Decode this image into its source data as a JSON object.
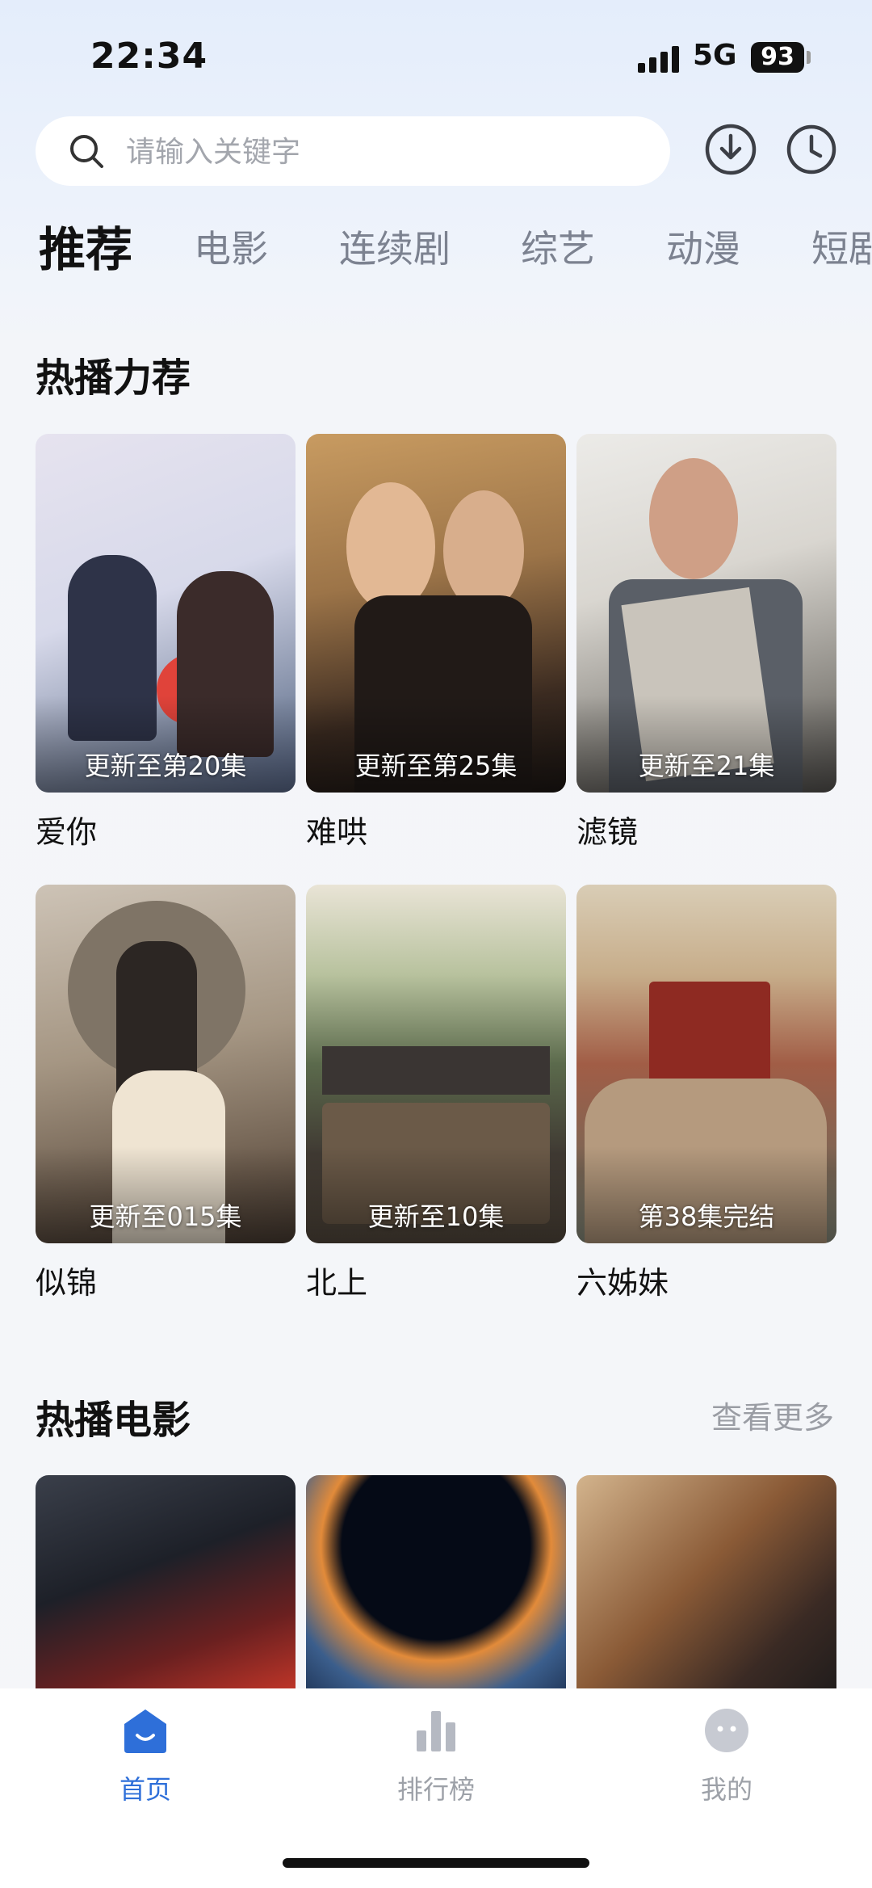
{
  "status_bar": {
    "time": "22:34",
    "network": "5G",
    "battery": "93"
  },
  "search": {
    "placeholder": "请输入关键字"
  },
  "tabs": [
    {
      "label": "推荐",
      "active": true
    },
    {
      "label": "电影"
    },
    {
      "label": "连续剧"
    },
    {
      "label": "综艺"
    },
    {
      "label": "动漫"
    },
    {
      "label": "短剧"
    }
  ],
  "hot_recommend": {
    "title": "热播力荐",
    "items": [
      {
        "title": "爱你",
        "badge": "更新至第20集"
      },
      {
        "title": "难哄",
        "badge": "更新至第25集"
      },
      {
        "title": "滤镜",
        "badge": "更新至21集"
      },
      {
        "title": "似锦",
        "badge": "更新至015集"
      },
      {
        "title": "北上",
        "badge": "更新至10集"
      },
      {
        "title": "六姊妹",
        "badge": "第38集完结"
      }
    ]
  },
  "hot_movies": {
    "title": "热播电影",
    "more": "查看更多"
  },
  "bottom_nav": [
    {
      "label": "首页",
      "icon": "home-icon",
      "active": true
    },
    {
      "label": "排行榜",
      "icon": "ranking-icon"
    },
    {
      "label": "我的",
      "icon": "profile-icon"
    }
  ],
  "colors": {
    "accent": "#2e6fd9",
    "inactive": "#9da1a8"
  }
}
